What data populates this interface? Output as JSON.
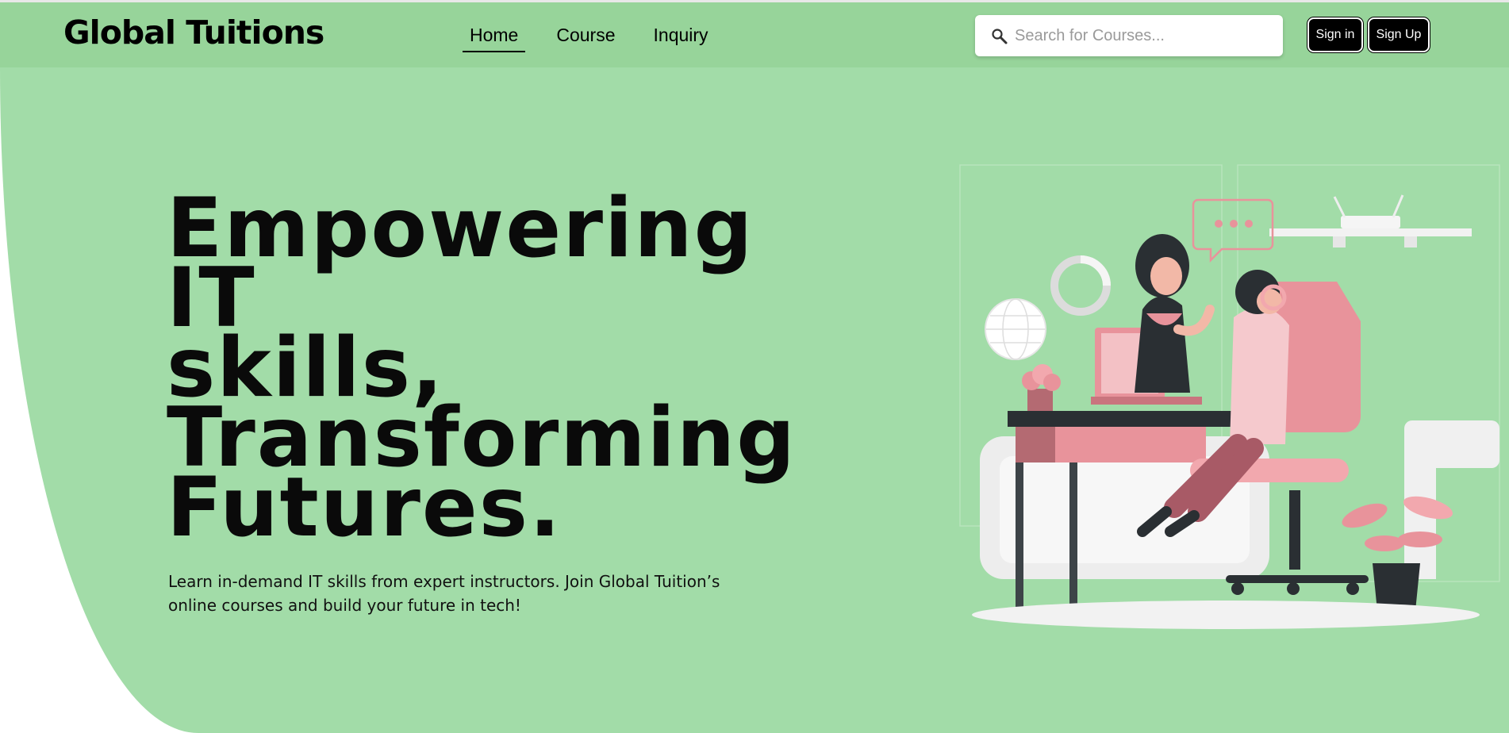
{
  "header": {
    "brand": "Global Tuitions",
    "nav": [
      {
        "label": "Home",
        "active": true
      },
      {
        "label": "Course",
        "active": false
      },
      {
        "label": "Inquiry",
        "active": false
      }
    ],
    "search": {
      "placeholder": "Search for Courses...",
      "value": "",
      "icon": "search-icon"
    },
    "signin_label": "Sign in",
    "signup_label": "Sign Up"
  },
  "hero": {
    "headline_lines": [
      "Empowering",
      "IT",
      "skills,",
      "Transforming",
      "Futures."
    ],
    "subtext": "Learn in-demand IT skills from expert instructors. Join Global Tuition’s online courses and build your future in tech!"
  },
  "colors": {
    "nav_bg": "#97d49a",
    "hero_bg": "#a2dca8",
    "button_bg": "#000000",
    "illustration_accent": "#e8939b"
  }
}
